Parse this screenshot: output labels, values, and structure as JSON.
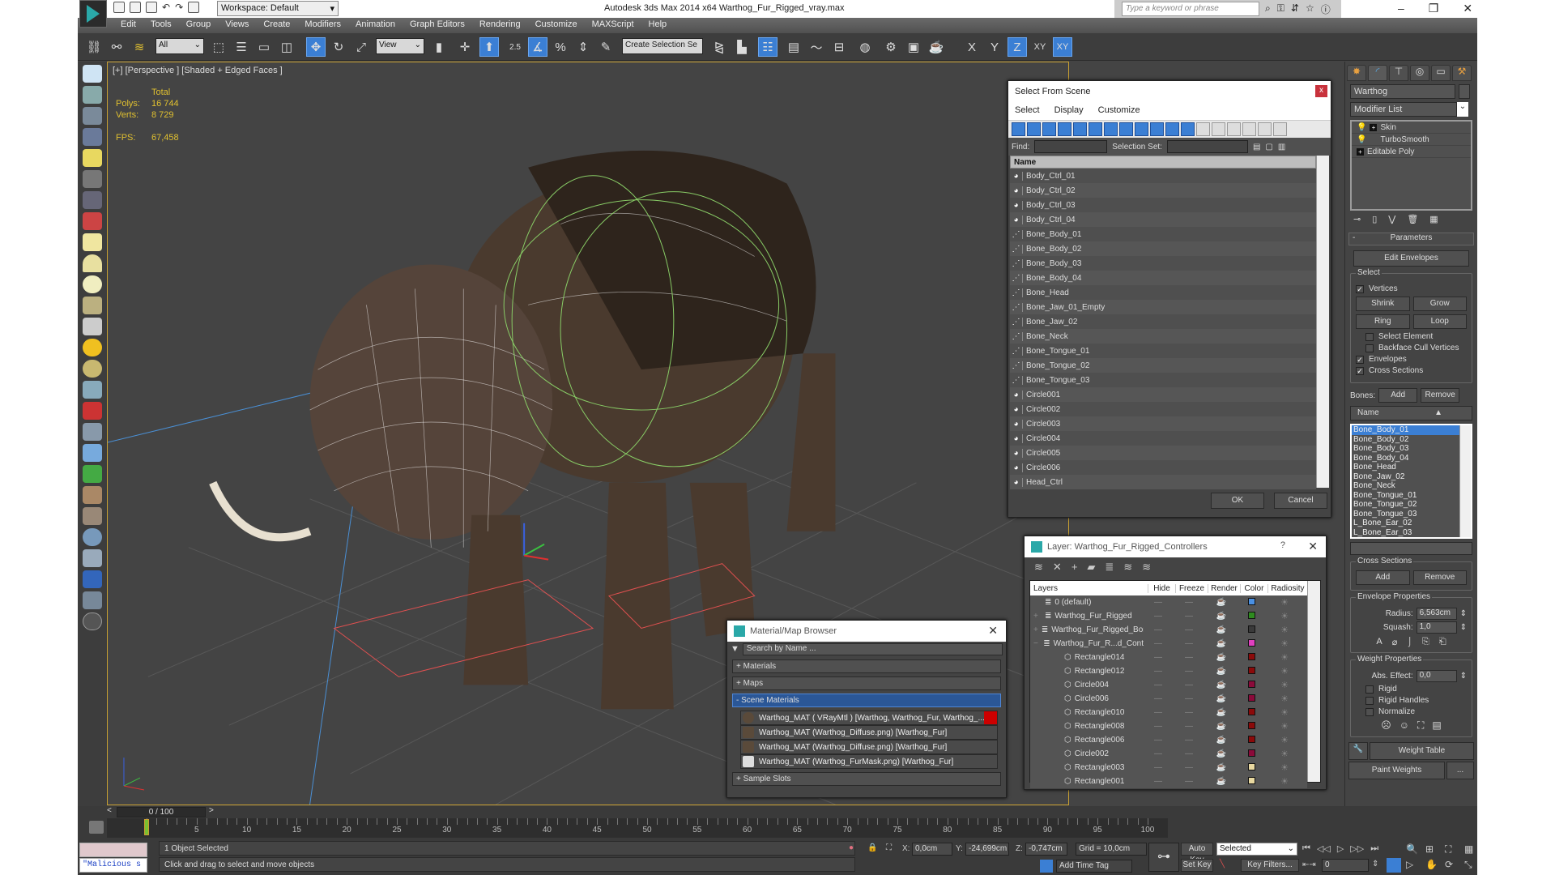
{
  "titlebar": {
    "workspace": "Workspace: Default",
    "app_title": "Autodesk 3ds Max  2014 x64     Warthog_Fur_Rigged_vray.max",
    "search_placeholder": "Type a keyword or phrase",
    "minimize": "–",
    "restore": "❐",
    "close": "✕"
  },
  "menu": [
    "Edit",
    "Tools",
    "Group",
    "Views",
    "Create",
    "Modifiers",
    "Animation",
    "Graph Editors",
    "Rendering",
    "Customize",
    "MAXScript",
    "Help"
  ],
  "toolbar": {
    "selection_filter": "All",
    "ref_coord": "View",
    "snap_angle": "2.5",
    "named_selection_placeholder": "Create Selection Se",
    "axis_x": "X",
    "axis_y": "Y",
    "axis_z": "Z",
    "axis_xy": "XY",
    "axis_xy2": "XY"
  },
  "viewport": {
    "label": "[+] [Perspective ] [Shaded + Edged Faces ]",
    "stats_header": "Total",
    "polys_label": "Polys:",
    "polys_value": "16 744",
    "verts_label": "Verts:",
    "verts_value": "8 729",
    "fps_label": "FPS:",
    "fps_value": "67,458"
  },
  "select_from_scene": {
    "title": "Select From Scene",
    "close": "x",
    "menu": [
      "Select",
      "Display",
      "Customize"
    ],
    "find_label": "Find:",
    "selection_set_label": "Selection Set:",
    "column_name": "Name",
    "items": [
      {
        "name": "Body_Ctrl_01",
        "type": "shape"
      },
      {
        "name": "Body_Ctrl_02",
        "type": "shape"
      },
      {
        "name": "Body_Ctrl_03",
        "type": "shape"
      },
      {
        "name": "Body_Ctrl_04",
        "type": "shape"
      },
      {
        "name": "Bone_Body_01",
        "type": "bone"
      },
      {
        "name": "Bone_Body_02",
        "type": "bone"
      },
      {
        "name": "Bone_Body_03",
        "type": "bone"
      },
      {
        "name": "Bone_Body_04",
        "type": "bone"
      },
      {
        "name": "Bone_Head",
        "type": "bone"
      },
      {
        "name": "Bone_Jaw_01_Empty",
        "type": "bone"
      },
      {
        "name": "Bone_Jaw_02",
        "type": "bone"
      },
      {
        "name": "Bone_Neck",
        "type": "bone"
      },
      {
        "name": "Bone_Tongue_01",
        "type": "bone"
      },
      {
        "name": "Bone_Tongue_02",
        "type": "bone"
      },
      {
        "name": "Bone_Tongue_03",
        "type": "bone"
      },
      {
        "name": "Circle001",
        "type": "shape"
      },
      {
        "name": "Circle002",
        "type": "shape"
      },
      {
        "name": "Circle003",
        "type": "shape"
      },
      {
        "name": "Circle004",
        "type": "shape"
      },
      {
        "name": "Circle005",
        "type": "shape"
      },
      {
        "name": "Circle006",
        "type": "shape"
      },
      {
        "name": "Head_Ctrl",
        "type": "shape"
      }
    ],
    "ok": "OK",
    "cancel": "Cancel"
  },
  "layer_dialog": {
    "title": "Layer: Warthog_Fur_Rigged_Controllers",
    "help": "?",
    "close": "✕",
    "columns": [
      "Layers",
      "Hide",
      "Freeze",
      "Render",
      "Color",
      "Radiosity"
    ],
    "rows": [
      {
        "name": "0 (default)",
        "indent": 0,
        "expander": "",
        "color": "#4a90e2"
      },
      {
        "name": "Warthog_Fur_Rigged",
        "indent": 0,
        "expander": "+",
        "color": "#2e8b1e"
      },
      {
        "name": "Warthog_Fur_Rigged_Bor",
        "indent": 0,
        "expander": "+",
        "color": "#3a3a3a"
      },
      {
        "name": "Warthog_Fur_R...d_Cont",
        "indent": 0,
        "expander": "−",
        "color": "#e040c0"
      },
      {
        "name": "Rectangle014",
        "indent": 1,
        "expander": "",
        "color": "#8b0a0a"
      },
      {
        "name": "Rectangle012",
        "indent": 1,
        "expander": "",
        "color": "#8b0a0a"
      },
      {
        "name": "Circle004",
        "indent": 1,
        "expander": "",
        "color": "#8b0a3a"
      },
      {
        "name": "Circle006",
        "indent": 1,
        "expander": "",
        "color": "#8b0a3a"
      },
      {
        "name": "Rectangle010",
        "indent": 1,
        "expander": "",
        "color": "#8b0a0a"
      },
      {
        "name": "Rectangle008",
        "indent": 1,
        "expander": "",
        "color": "#8b0a0a"
      },
      {
        "name": "Rectangle006",
        "indent": 1,
        "expander": "",
        "color": "#8b0a0a"
      },
      {
        "name": "Circle002",
        "indent": 1,
        "expander": "",
        "color": "#8b0a3a"
      },
      {
        "name": "Rectangle003",
        "indent": 1,
        "expander": "",
        "color": "#e8d8a0"
      },
      {
        "name": "Rectangle001",
        "indent": 1,
        "expander": "",
        "color": "#e8d8a0"
      }
    ]
  },
  "material_browser": {
    "title": "Material/Map Browser",
    "close": "✕",
    "search_placeholder": "Search by Name ...",
    "sections": [
      "+ Materials",
      "+ Maps",
      "- Scene Materials"
    ],
    "items": [
      "Warthog_MAT  ( VRayMtl )  [Warthog, Warthog_Fur, Warthog_...",
      "Warthog_MAT (Warthog_Diffuse.png) [Warthog_Fur]",
      "Warthog_MAT (Warthog_Diffuse.png) [Warthog_Fur]",
      "Warthog_MAT (Warthog_FurMask.png) [Warthog_Fur]"
    ],
    "sample_slots": "+ Sample Slots"
  },
  "command_panel": {
    "object_name": "Warthog",
    "modifier_list": "Modifier List",
    "stack": [
      {
        "name": "Skin",
        "bulb": true,
        "plus": true
      },
      {
        "name": "TurboSmooth",
        "bulb": true,
        "plus": false
      },
      {
        "name": "Editable Poly",
        "bulb": false,
        "plus": true
      }
    ],
    "rollout_title": "Parameters",
    "rollout_collapse": "-",
    "edit_envelopes": "Edit Envelopes",
    "select_group": "Select",
    "vertices": {
      "label": "Vertices",
      "checked": true
    },
    "shrink": "Shrink",
    "grow": "Grow",
    "ring": "Ring",
    "loop": "Loop",
    "select_element": {
      "label": "Select Element",
      "checked": false
    },
    "backface_cull": {
      "label": "Backface Cull Vertices",
      "checked": false
    },
    "envelopes": {
      "label": "Envelopes",
      "checked": true
    },
    "cross_sections_cb": {
      "label": "Cross Sections",
      "checked": true
    },
    "bones_label": "Bones:",
    "add": "Add",
    "remove": "Remove",
    "bones_col": "Name",
    "bones": [
      "Bone_Body_01",
      "Bone_Body_02",
      "Bone_Body_03",
      "Bone_Body_04",
      "Bone_Head",
      "Bone_Jaw_02",
      "Bone_Neck",
      "Bone_Tongue_01",
      "Bone_Tongue_02",
      "Bone_Tongue_03",
      "L_Bone_Ear_02",
      "L_Bone_Ear_03"
    ],
    "bones_selected": "Bone_Body_01",
    "cross_sections_group": "Cross Sections",
    "cs_add": "Add",
    "cs_remove": "Remove",
    "envelope_props": "Envelope Properties",
    "radius_label": "Radius:",
    "radius_value": "6,563cm",
    "squash_label": "Squash:",
    "squash_value": "1,0",
    "weight_props": "Weight Properties",
    "abs_effect_label": "Abs. Effect:",
    "abs_effect_value": "0,0",
    "rigid": {
      "label": "Rigid",
      "checked": false
    },
    "rigid_handles": {
      "label": "Rigid Handles",
      "checked": false
    },
    "normalize": {
      "label": "Normalize",
      "checked": false
    },
    "weight_table": "Weight Table",
    "paint_weights": "Paint Weights",
    "more": "..."
  },
  "timeline": {
    "frame_display": "0 / 100",
    "prev": "<",
    "next": ">",
    "ticks": [
      0,
      5,
      10,
      15,
      20,
      25,
      30,
      35,
      40,
      45,
      50,
      55,
      60,
      65,
      70,
      75,
      80,
      85,
      90,
      95,
      100
    ]
  },
  "status": {
    "selection": "1 Object Selected",
    "prompt": "Click and drag to select and move objects",
    "maxscript_output": "\"Malicious s",
    "x_label": "X:",
    "x_value": "0,0cm",
    "y_label": "Y:",
    "y_value": "-24,699cm",
    "z_label": "Z:",
    "z_value": "-0,747cm",
    "grid": "Grid = 10,0cm",
    "add_time_tag": "Add Time Tag",
    "auto_key": "Auto Key",
    "set_key": "Set Key",
    "key_mode": "Selected",
    "key_filters": "Key Filters...",
    "current_frame": "0"
  }
}
